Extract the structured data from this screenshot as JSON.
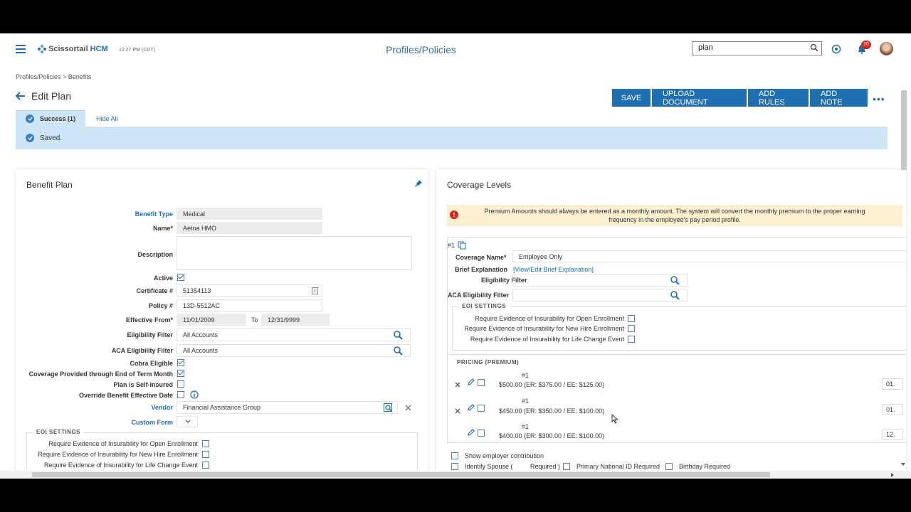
{
  "header": {
    "brand": "Scissortail",
    "brand_suffix": "HCM",
    "time": "12:27 PM (CDT)",
    "page_title": "Profiles/Policies",
    "search_value": "plan",
    "notifications_count": "20"
  },
  "breadcrumb": "Profiles/Policies  >  Benefits",
  "page": {
    "title": "Edit Plan"
  },
  "toolbar": {
    "save": "SAVE",
    "upload": "UPLOAD DOCUMENT",
    "add_rules": "ADD RULES",
    "add_note": "ADD NOTE",
    "more": "•••"
  },
  "notice": {
    "tab_success": "Success (1)",
    "hide_all": "Hide All",
    "message": "Saved."
  },
  "benefit_plan": {
    "title": "Benefit Plan",
    "benefit_type_label": "Benefit Type",
    "benefit_type": "Medical",
    "name_label": "Name*",
    "name": "Aetna HMO",
    "description_label": "Description",
    "active_label": "Active",
    "certificate_label": "Certificate #",
    "certificate": "51354113",
    "policy_label": "Policy #",
    "policy": "13D-5512AC",
    "effective_from_label": "Effective From*",
    "effective_from": "11/01/2009",
    "to_label": "To",
    "effective_to": "12/31/9999",
    "eligibility_label": "Eligibility Filter",
    "eligibility": "All Accounts",
    "aca_label": "ACA Eligibility Filter",
    "aca": "All Accounts",
    "cobra_label": "Cobra Eligible",
    "coverage_end_label": "Coverage Provided through End of Term Month",
    "self_insured_label": "Plan is Self-insured",
    "override_label": "Override Benefit Effective Date",
    "vendor_label": "Vendor",
    "vendor": "Financial Assistance Group",
    "custom_form_label": "Custom Form",
    "eoi_title": "EOI SETTINGS",
    "eoi_open": "Require Evidence of Insurability for Open Enrollment",
    "eoi_new_hire": "Require Evidence of Insurability for New Hire Enrollment",
    "eoi_life": "Require Evidence of Insurability for Life Change Event"
  },
  "coverage": {
    "title": "Coverage Levels",
    "warning_line1": "Premium Amounts should always be entered as a monthly amount. The system will convert the monthly premium to the proper earning",
    "warning_line2": "frequency in the employee's pay period profile.",
    "item_num": "#1",
    "coverage_name_label": "Coverage Name*",
    "coverage_name": "Employee Only",
    "brief_label": "Brief Explanation",
    "brief_link": "[View/Edit Brief Explanation]",
    "eligibility_label": "Eligibility Filter",
    "aca_label": "ACA Eligibility Filter",
    "eoi_title": "EOI SETTINGS",
    "eoi_open": "Require Evidence of Insurability for Open Enrollment",
    "eoi_new_hire": "Require Evidence of Insurability for New Hire Enrollment",
    "eoi_life": "Require Evidence of Insurability for Life Change Event",
    "pricing_title": "PRICING (PREMIUM)",
    "pricing": [
      {
        "num": "#1",
        "amount": "$500.00 (ER: $375.00 / EE: $125.00)",
        "date": "01."
      },
      {
        "num": "#1",
        "amount": "$450.00 (ER: $350.00 / EE: $100.00)",
        "date": "01."
      },
      {
        "num": "#1",
        "amount": "$400.00 (ER: $300.00 / EE: $100.00)",
        "date": "12."
      }
    ],
    "show_employer": "Show employer contribution",
    "identify_spouse": "Identify Spouse (",
    "required": "Required )",
    "primary_national": "Primary National ID Required",
    "birthday_required": "Birthday Required"
  }
}
